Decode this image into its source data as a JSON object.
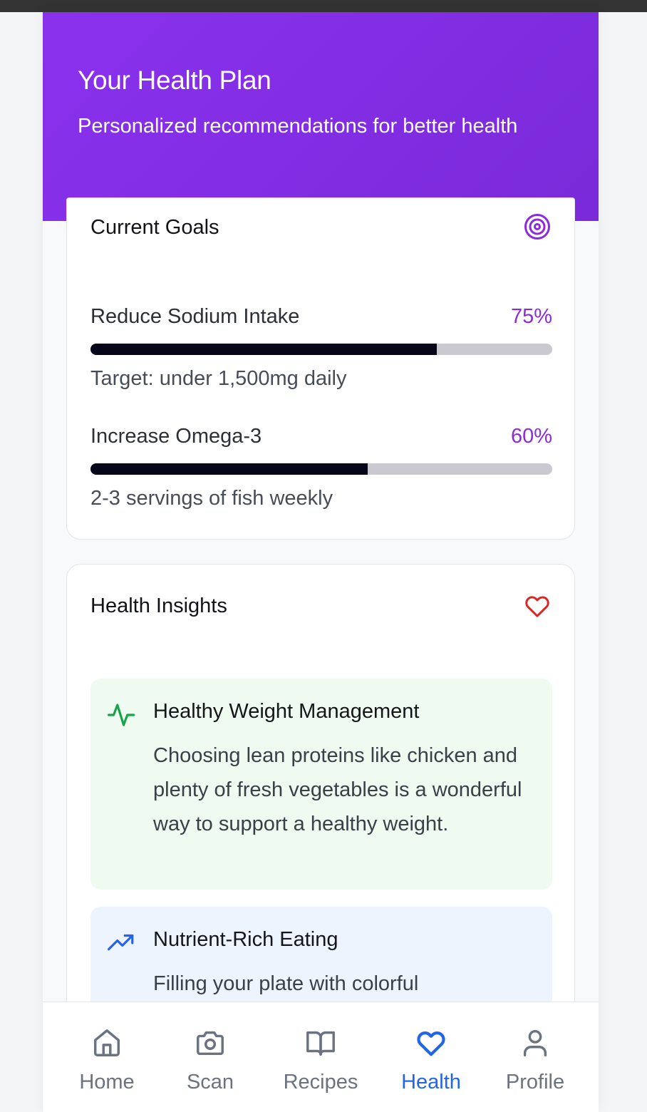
{
  "header": {
    "title": "Your Health Plan",
    "subtitle": "Personalized recommendations for better health"
  },
  "goals_card": {
    "title": "Current Goals",
    "icon": "target-icon",
    "goals": [
      {
        "name": "Reduce Sodium Intake",
        "percent_label": "75%",
        "progress": 0.75,
        "note": "Target: under 1,500mg daily"
      },
      {
        "name": "Increase Omega-3",
        "percent_label": "60%",
        "progress": 0.6,
        "note": "2-3 servings of fish weekly"
      }
    ]
  },
  "insights_card": {
    "title": "Health Insights",
    "icon": "heart-icon",
    "items": [
      {
        "icon": "activity-pulse-icon",
        "title": "Healthy Weight Management",
        "body": "Choosing lean proteins like chicken and plenty of fresh vegetables is a wonderful way to support a healthy weight."
      },
      {
        "icon": "trending-up-icon",
        "title": "Nutrient-Rich Eating",
        "body": "Filling your plate with colorful"
      }
    ]
  },
  "nav": {
    "items": [
      {
        "label": "Home",
        "icon": "home-icon",
        "active": false
      },
      {
        "label": "Scan",
        "icon": "camera-icon",
        "active": false
      },
      {
        "label": "Recipes",
        "icon": "book-open-icon",
        "active": false
      },
      {
        "label": "Health",
        "icon": "heart-icon",
        "active": true
      },
      {
        "label": "Profile",
        "icon": "user-icon",
        "active": false
      }
    ]
  },
  "colors": {
    "header_gradient_start": "#8a31ee",
    "header_gradient_end": "#7a2ad9",
    "accent_purple": "#8a2be2",
    "heart_red": "#dc2626",
    "insight_green": "#16a34a",
    "insight_blue": "#2563eb",
    "nav_active": "#2266e8",
    "progress_fill": "#050617"
  }
}
